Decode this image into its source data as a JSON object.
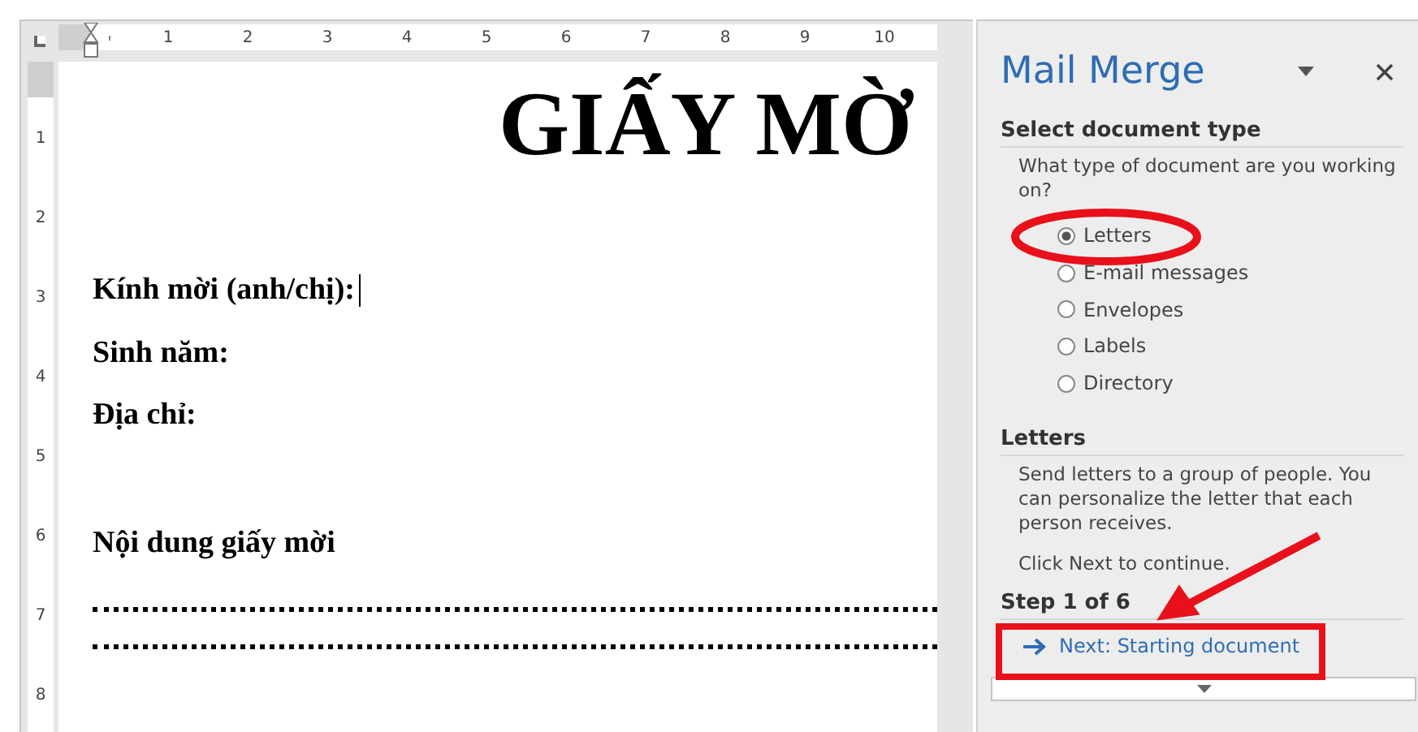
{
  "ruler": {
    "horizontal": [
      "1",
      "2",
      "3",
      "4",
      "5",
      "6",
      "7",
      "8",
      "9",
      "10"
    ],
    "vertical": [
      "1",
      "2",
      "3",
      "4",
      "5",
      "6",
      "7",
      "8"
    ]
  },
  "document": {
    "title": "GIẤY MỜ",
    "lines": [
      {
        "kind": "text",
        "text": "Kính mời (anh/chị):",
        "cursor": true
      },
      {
        "kind": "text",
        "text": "Sinh năm:",
        "cursor": false
      },
      {
        "kind": "text",
        "text": "Địa chỉ:",
        "cursor": false
      },
      {
        "kind": "blank"
      },
      {
        "kind": "text",
        "text": "Nội dung giấy mời",
        "cursor": false
      },
      {
        "kind": "dots"
      },
      {
        "kind": "dots"
      }
    ]
  },
  "pane": {
    "title": "Mail Merge",
    "section_1": {
      "heading": "Select document type",
      "question": "What type of document are you working on?"
    },
    "document_types": [
      {
        "label": "Letters",
        "selected": true
      },
      {
        "label": "E-mail messages",
        "selected": false
      },
      {
        "label": "Envelopes",
        "selected": false
      },
      {
        "label": "Labels",
        "selected": false
      },
      {
        "label": "Directory",
        "selected": false
      }
    ],
    "section_2": {
      "heading": "Letters",
      "description": "Send letters to a group of people. You can personalize the letter that each person receives.",
      "hint": "Click Next to continue."
    },
    "step": "Step 1 of 6",
    "next_link": "Next: Starting document"
  }
}
